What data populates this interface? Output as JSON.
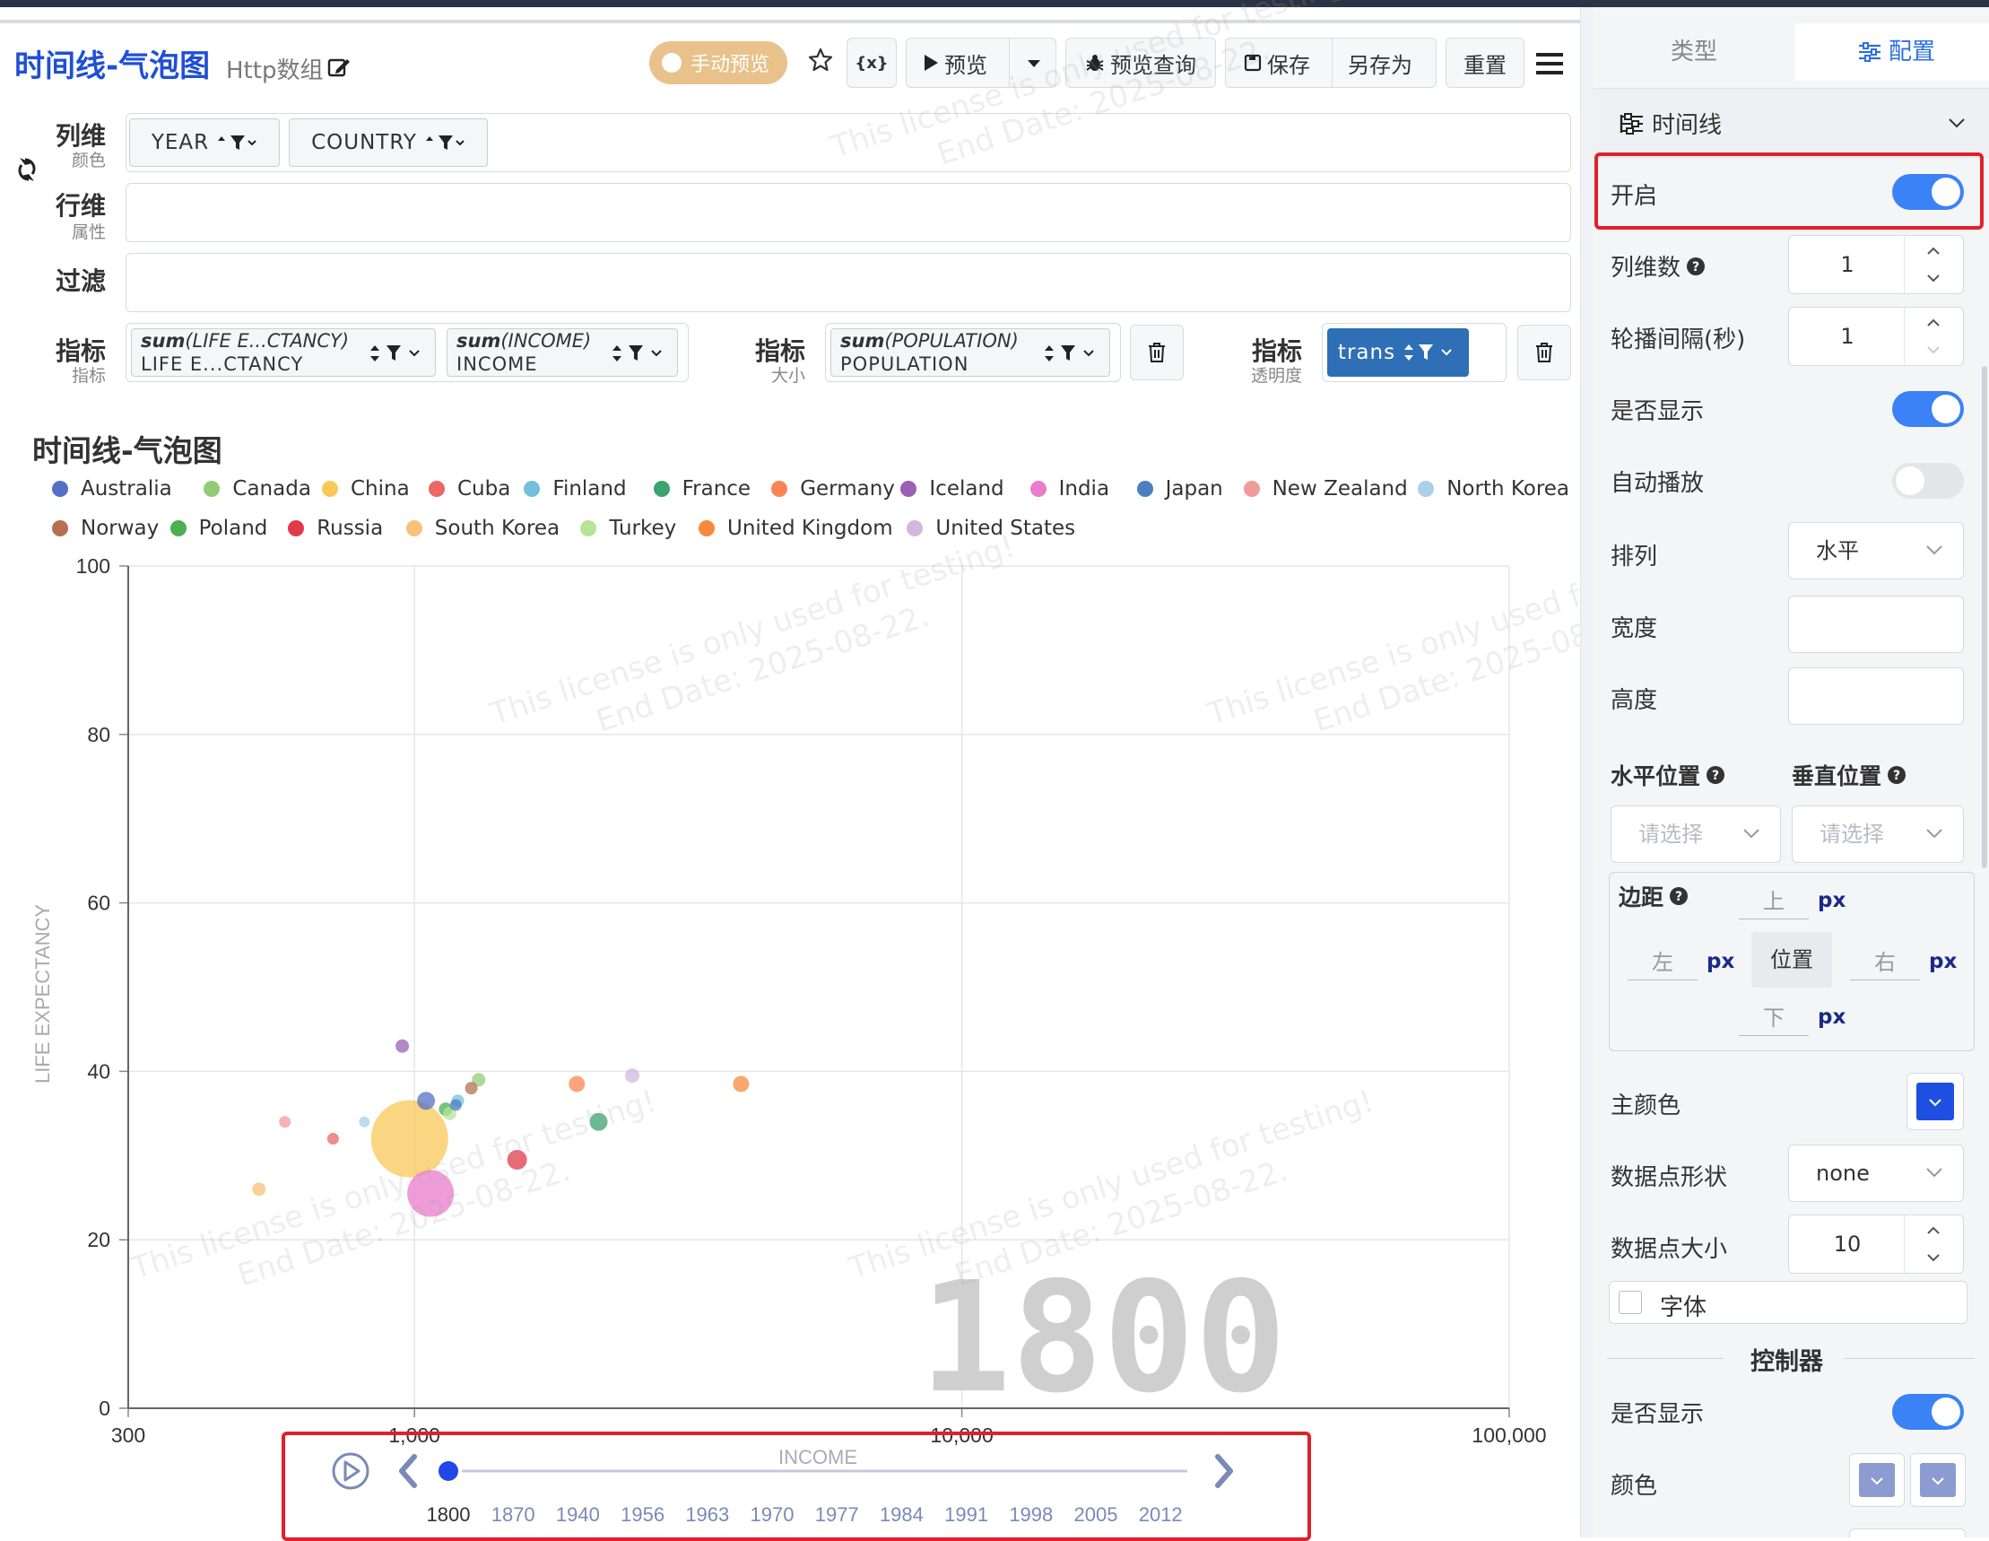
{
  "header": {
    "title": "时间线-气泡图",
    "subtitle": "Http数组",
    "manual_preview": "手动预览",
    "var_label": "{x}",
    "preview": "预览",
    "preview_query": "预览查询",
    "save": "保存",
    "save_as": "另存为",
    "reset": "重置"
  },
  "config_rows": {
    "col_dim": {
      "label": "列维",
      "sub": "颜色",
      "tags": [
        "YEAR",
        "COUNTRY"
      ]
    },
    "row_dim": {
      "label": "行维",
      "sub": "属性"
    },
    "filter": {
      "label": "过滤"
    },
    "metric1": {
      "label": "指标",
      "sub": "指标",
      "tags": [
        {
          "fn": "sum",
          "arg": "LIFE E...CTANCY",
          "name": "LIFE E...CTANCY"
        },
        {
          "fn": "sum",
          "arg": "INCOME",
          "name": "INCOME"
        }
      ]
    },
    "metric2": {
      "label": "指标",
      "sub": "大小",
      "tag": {
        "fn": "sum",
        "arg": "POPULATION",
        "name": "POPULATION"
      }
    },
    "metric3": {
      "label": "指标",
      "sub": "透明度",
      "tag": "trans"
    }
  },
  "chart": {
    "heading": "时间线-气泡图",
    "timeline_axis_name": "INCOME",
    "year_watermark": "1800",
    "timeline_years": [
      "1800",
      "1870",
      "1940",
      "1956",
      "1963",
      "1970",
      "1977",
      "1984",
      "1991",
      "1998",
      "2005",
      "2012"
    ],
    "timeline_current": "1800",
    "legend": [
      {
        "name": "Australia",
        "color": "#5470c6"
      },
      {
        "name": "Canada",
        "color": "#91cc75"
      },
      {
        "name": "China",
        "color": "#fac858"
      },
      {
        "name": "Cuba",
        "color": "#ee6666"
      },
      {
        "name": "Finland",
        "color": "#73c0de"
      },
      {
        "name": "France",
        "color": "#3ba272"
      },
      {
        "name": "Germany",
        "color": "#fc8452"
      },
      {
        "name": "Iceland",
        "color": "#9a60b4"
      },
      {
        "name": "India",
        "color": "#ea7ccc"
      },
      {
        "name": "Japan",
        "color": "#4a7fc1"
      },
      {
        "name": "New Zealand",
        "color": "#f19a9a"
      },
      {
        "name": "North Korea",
        "color": "#a8d0e6"
      },
      {
        "name": "Norway",
        "color": "#b5704f"
      },
      {
        "name": "Poland",
        "color": "#4caf50"
      },
      {
        "name": "Russia",
        "color": "#e03a4a"
      },
      {
        "name": "South Korea",
        "color": "#f8c27a"
      },
      {
        "name": "Turkey",
        "color": "#b7e39a"
      },
      {
        "name": "United Kingdom",
        "color": "#f58a3c"
      },
      {
        "name": "United States",
        "color": "#d2b7e0"
      }
    ]
  },
  "chart_data": {
    "type": "scatter",
    "title": "时间线-气泡图",
    "xlabel": "INCOME",
    "ylabel": "LIFE EXPECTANCY",
    "x_scale": "log",
    "xlim": [
      300,
      100000
    ],
    "ylim": [
      0,
      100
    ],
    "x_ticks": [
      "300",
      "1,000",
      "10,000",
      "100,000"
    ],
    "y_ticks": [
      "0",
      "20",
      "40",
      "60",
      "80",
      "100"
    ],
    "grid": true,
    "legend_position": "top",
    "year": "1800",
    "points": [
      {
        "name": "Australia",
        "x": 1050,
        "y": 36.5,
        "size": 14
      },
      {
        "name": "China",
        "x": 980,
        "y": 32,
        "size": 80
      },
      {
        "name": "India",
        "x": 1070,
        "y": 25.5,
        "size": 46
      },
      {
        "name": "Russia",
        "x": 1540,
        "y": 29.5,
        "size": 16
      },
      {
        "name": "France",
        "x": 2170,
        "y": 34,
        "size": 14
      },
      {
        "name": "United Kingdom",
        "x": 3950,
        "y": 38.5,
        "size": 12
      },
      {
        "name": "Germany",
        "x": 1980,
        "y": 38.5,
        "size": 12
      },
      {
        "name": "United States",
        "x": 2500,
        "y": 39.5,
        "size": 10
      },
      {
        "name": "Iceland",
        "x": 950,
        "y": 43,
        "size": 9
      },
      {
        "name": "Canada",
        "x": 1310,
        "y": 39,
        "size": 9
      },
      {
        "name": "Norway",
        "x": 1270,
        "y": 38,
        "size": 8
      },
      {
        "name": "Finland",
        "x": 1200,
        "y": 36.5,
        "size": 8
      },
      {
        "name": "Poland",
        "x": 1140,
        "y": 35.5,
        "size": 9
      },
      {
        "name": "Turkey",
        "x": 1160,
        "y": 35,
        "size": 9
      },
      {
        "name": "Japan",
        "x": 1190,
        "y": 36,
        "size": 7
      },
      {
        "name": "New Zealand",
        "x": 580,
        "y": 34,
        "size": 7
      },
      {
        "name": "Cuba",
        "x": 710,
        "y": 32,
        "size": 7
      },
      {
        "name": "South Korea",
        "x": 520,
        "y": 26,
        "size": 9
      },
      {
        "name": "North Korea",
        "x": 810,
        "y": 34,
        "size": 6
      }
    ]
  },
  "panel": {
    "tab_type": "类型",
    "tab_config": "配置",
    "section": "时间线",
    "fields": {
      "enable": "开启",
      "col_count": "列维数",
      "col_count_value": "1",
      "interval": "轮播间隔(秒)",
      "interval_value": "1",
      "show": "是否显示",
      "autoplay": "自动播放",
      "orient": "排列",
      "orient_value": "水平",
      "width": "宽度",
      "height": "高度",
      "hpos": "水平位置",
      "vpos": "垂直位置",
      "placeholder": "请选择",
      "margin": "边距",
      "top": "上",
      "left": "左",
      "right": "右",
      "bottom": "下",
      "px": "px",
      "position_btn": "位置",
      "main_color": "主颜色",
      "main_color_value": "#1f4fe0",
      "symbol": "数据点形状",
      "symbol_value": "none",
      "symbol_size": "数据点大小",
      "symbol_size_value": "10",
      "font": "字体",
      "controller": "控制器",
      "ctrl_show": "是否显示",
      "ctrl_color": "颜色"
    },
    "states": {
      "enable": true,
      "show": true,
      "autoplay": false,
      "ctrl_show": true
    }
  },
  "watermark": {
    "line1": "This license is only used for testing!",
    "line2": "End Date: 2025-08-22."
  }
}
